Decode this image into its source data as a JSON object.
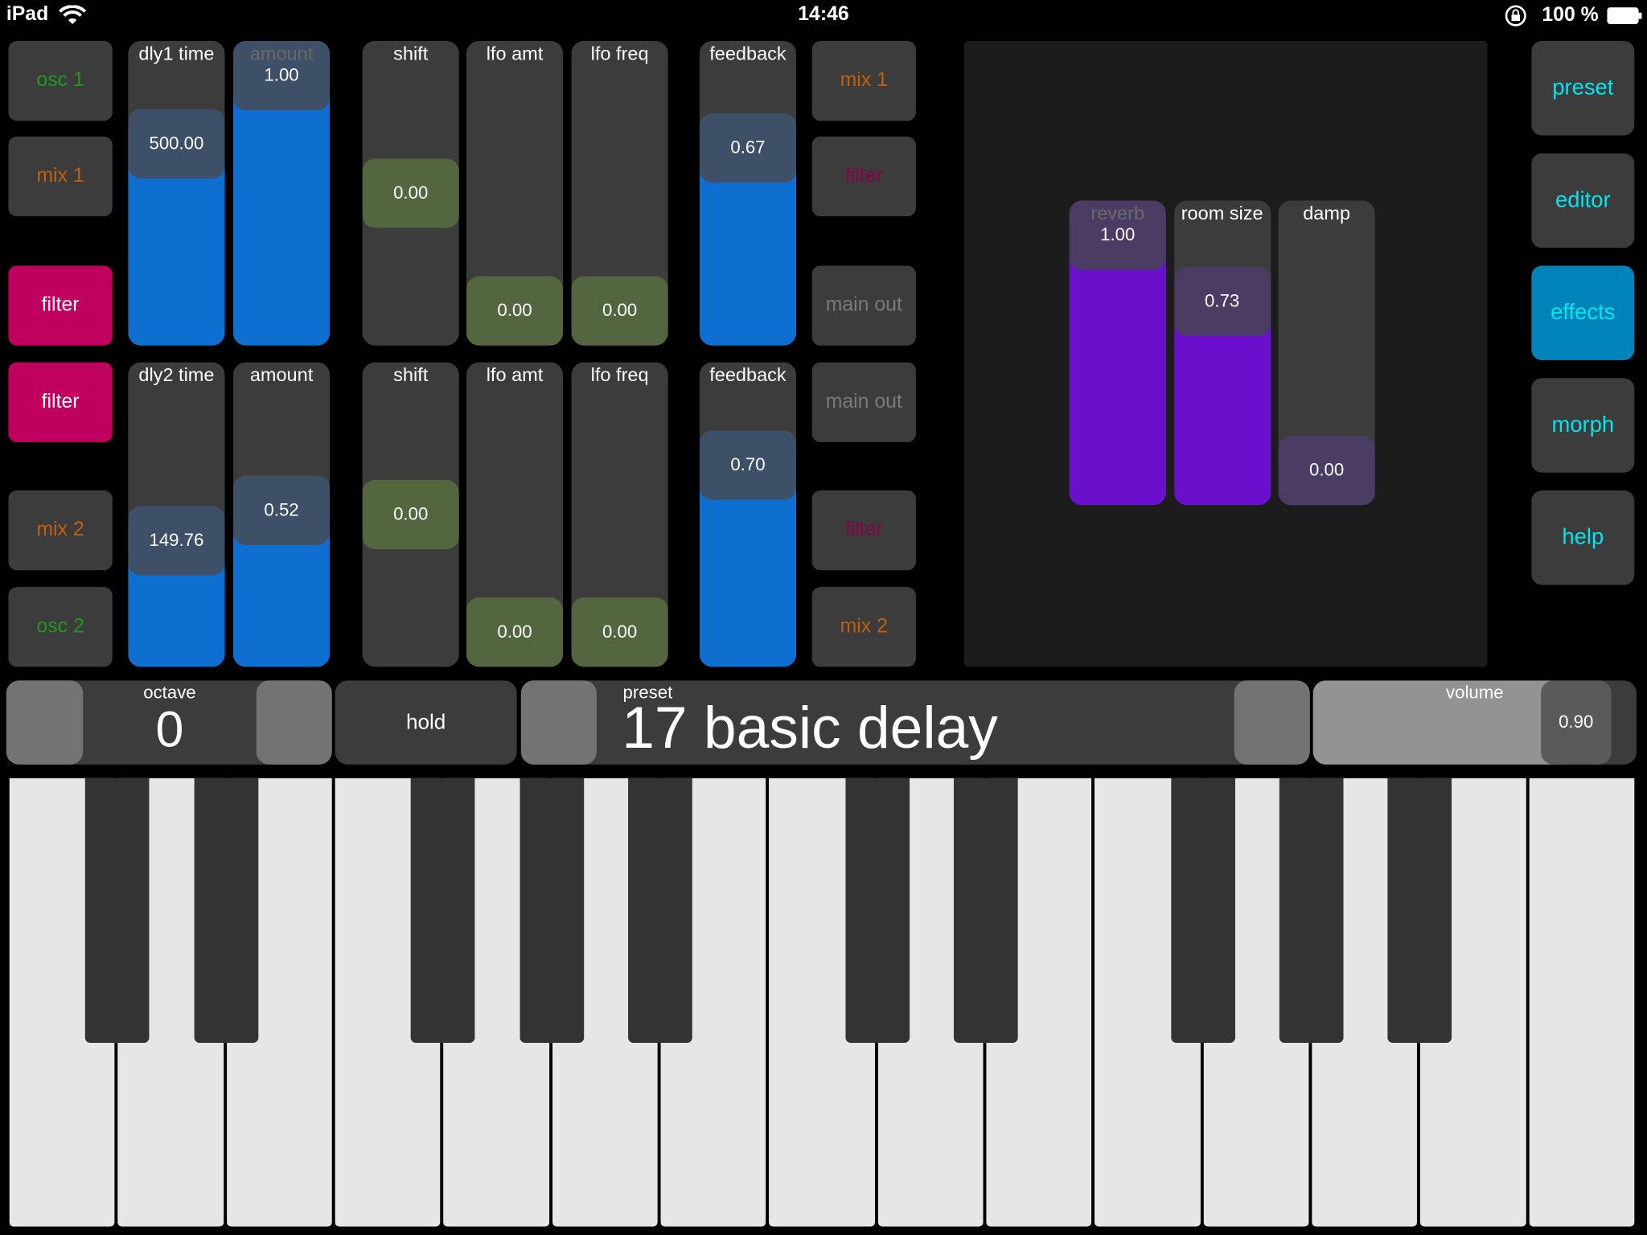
{
  "status_bar": {
    "device": "iPad",
    "time": "14:46",
    "battery": "100 %",
    "icons": [
      "wifi-icon",
      "rotation-lock-icon",
      "battery-icon"
    ]
  },
  "colors": {
    "blue_fill": "#0f6fd0",
    "blue_knob": "#3e5068",
    "green_knob": "#546640",
    "purple_fill": "#6a10cc",
    "purple_knob": "#4a3c62",
    "track": "#3c3c3c",
    "filter_active": "#c0005e",
    "nav_active": "#0083b8",
    "nav_text": "#00e5ee"
  },
  "left_routing": [
    {
      "label": "osc 1",
      "color": "#1f9a1f",
      "active": false
    },
    {
      "label": "mix 1",
      "color": "#c0600f",
      "active": false
    },
    {
      "label": "filter",
      "color": "#ffffff",
      "active": true
    },
    {
      "label": "filter",
      "color": "#ffffff",
      "active": true
    },
    {
      "label": "mix 2",
      "color": "#c0600f",
      "active": false
    },
    {
      "label": "osc 2",
      "color": "#1f9a1f",
      "active": false
    }
  ],
  "right_routing": [
    {
      "label": "mix 1",
      "color": "#c0600f"
    },
    {
      "label": "filter",
      "color": "#8a0048"
    },
    {
      "label": "main out",
      "color": "#7a7a7a"
    },
    {
      "label": "main out",
      "color": "#7a7a7a"
    },
    {
      "label": "filter",
      "color": "#8a0048"
    },
    {
      "label": "mix 2",
      "color": "#c0600f"
    }
  ],
  "delay1": [
    {
      "label": "dly1 time",
      "value": "500.00",
      "level": 0.71,
      "style": "blue",
      "label_color": "#ffffff"
    },
    {
      "label": "amount",
      "value": "1.00",
      "level": 1.0,
      "style": "blue",
      "label_color": "#6a6a6a"
    },
    {
      "label": "shift",
      "value": "0.00",
      "level": 0.5,
      "style": "green",
      "label_color": "#ffffff"
    },
    {
      "label": "lfo amt",
      "value": "0.00",
      "level": 0.0,
      "style": "green",
      "label_color": "#ffffff"
    },
    {
      "label": "lfo freq",
      "value": "0.00",
      "level": 0.0,
      "style": "green",
      "label_color": "#ffffff"
    },
    {
      "label": "feedback",
      "value": "0.67",
      "level": 0.69,
      "style": "blue",
      "label_color": "#ffffff"
    }
  ],
  "delay2": [
    {
      "label": "dly2 time",
      "value": "149.76",
      "level": 0.39,
      "style": "blue",
      "label_color": "#ffffff"
    },
    {
      "label": "amount",
      "value": "0.52",
      "level": 0.52,
      "style": "blue",
      "label_color": "#ffffff"
    },
    {
      "label": "shift",
      "value": "0.00",
      "level": 0.5,
      "style": "green",
      "label_color": "#ffffff"
    },
    {
      "label": "lfo amt",
      "value": "0.00",
      "level": 0.0,
      "style": "green",
      "label_color": "#ffffff"
    },
    {
      "label": "lfo freq",
      "value": "0.00",
      "level": 0.0,
      "style": "green",
      "label_color": "#ffffff"
    },
    {
      "label": "feedback",
      "value": "0.70",
      "level": 0.71,
      "style": "blue",
      "label_color": "#ffffff"
    }
  ],
  "reverb": [
    {
      "label": "reverb",
      "value": "1.00",
      "level": 1.0,
      "label_color": "#6a6a6a"
    },
    {
      "label": "room size",
      "value": "0.73",
      "level": 0.72,
      "label_color": "#ffffff"
    },
    {
      "label": "damp",
      "value": "0.00",
      "level": 0.0,
      "label_color": "#ffffff"
    }
  ],
  "nav": [
    {
      "label": "preset",
      "active": false
    },
    {
      "label": "editor",
      "active": false
    },
    {
      "label": "effects",
      "active": true
    },
    {
      "label": "morph",
      "active": false
    },
    {
      "label": "help",
      "active": false
    }
  ],
  "bottom": {
    "octave_label": "octave",
    "octave_value": "0",
    "hold_label": "hold",
    "preset_label": "preset",
    "preset_name": "17 basic delay",
    "volume_label": "volume",
    "volume_value": "0.90",
    "volume_level": 0.9
  }
}
